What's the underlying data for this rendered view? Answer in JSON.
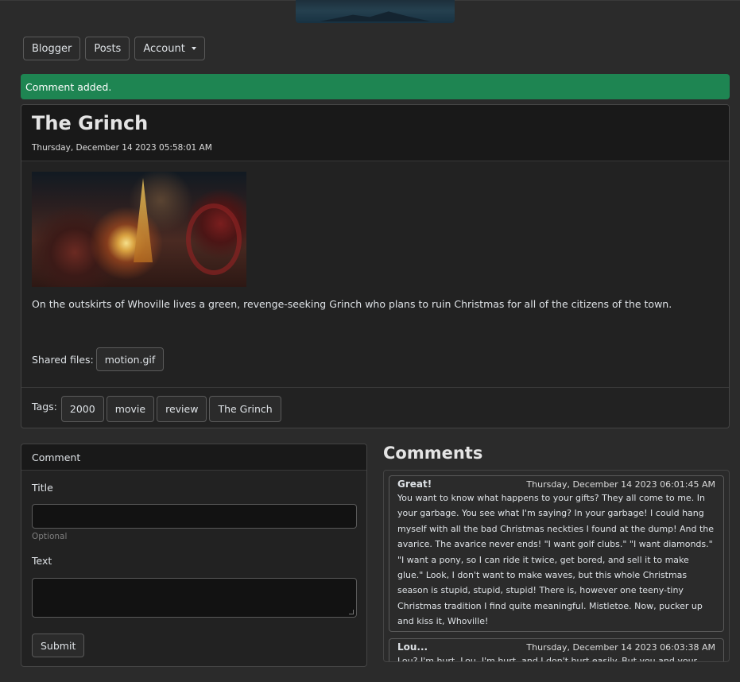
{
  "nav": {
    "blogger_label": "Blogger",
    "posts_label": "Posts",
    "account_label": "Account"
  },
  "alert": {
    "message": "Comment added."
  },
  "post": {
    "title": "The Grinch",
    "date": "Thursday, December 14 2023 05:58:01 AM",
    "body": "On the outskirts of Whoville lives a green, revenge-seeking Grinch who plans to ruin Christmas for all of the citizens of the town.",
    "shared_files_label": "Shared files:",
    "files": [
      "motion.gif"
    ],
    "tags_label": "Tags:",
    "tags": [
      "2000",
      "movie",
      "review",
      "The Grinch"
    ]
  },
  "comment_form": {
    "header": "Comment",
    "title_label": "Title",
    "title_value": "",
    "title_hint": "Optional",
    "text_label": "Text",
    "text_value": "",
    "submit_label": "Submit"
  },
  "comments": {
    "heading": "Comments",
    "items": [
      {
        "title": "Great!",
        "date": "Thursday, December 14 2023 06:01:45 AM",
        "text": "You want to know what happens to your gifts? They all come to me. In your garbage. You see what I'm saying? In your garbage! I could hang myself with all the bad Christmas neckties I found at the dump! And the avarice. The avarice never ends! \"I want golf clubs.\" \"I want diamonds.\" \"I want a pony, so I can ride it twice, get bored, and sell it to make glue.\" Look, I don't want to make waves, but this whole Christmas season is stupid, stupid, stupid! There is, however one teeny-tiny Christmas tradition I find quite meaningful. Mistletoe. Now, pucker up and kiss it, Whoville!"
      },
      {
        "title": "Lou...",
        "date": "Thursday, December 14 2023 06:03:38 AM",
        "text": "Lou? I'm hurt, Lou. I'm hurt, and I don't hurt easily. But you and your family.... I'm so disappointed. Can we just get back to Christmas the way it should be?"
      }
    ]
  },
  "colors": {
    "background": "#2b2b2b",
    "card": "#222222",
    "alert_success": "#1e8552",
    "text": "#dee2e6"
  }
}
